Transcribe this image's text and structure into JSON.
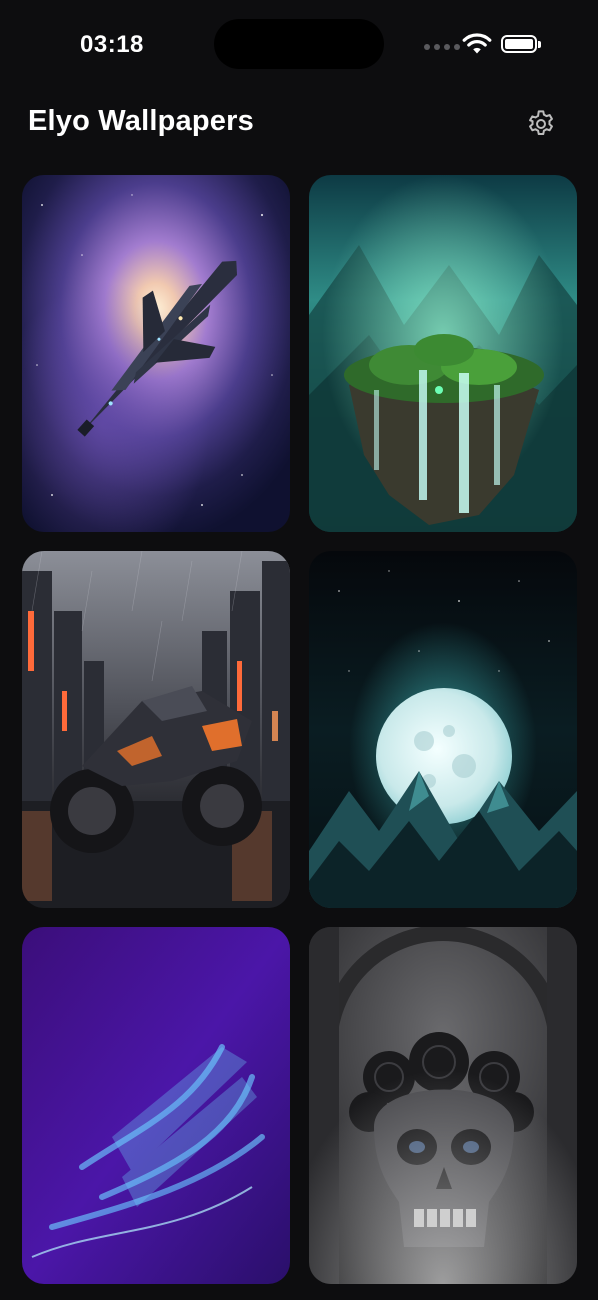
{
  "status_bar": {
    "time": "03:18",
    "wifi_icon": "wifi-icon",
    "battery_icon": "battery-icon",
    "signal_icon": "cellular-dots-icon"
  },
  "header": {
    "title": "Elyo Wallpapers",
    "settings_icon": "gear-icon"
  },
  "wallpapers": [
    {
      "name": "spaceship-nebula",
      "accent": "#b9a2e8"
    },
    {
      "name": "floating-island-waterfall",
      "accent": "#2fd9b0"
    },
    {
      "name": "motorcycle-rainy-city",
      "accent": "#ff8a3a"
    },
    {
      "name": "moon-over-mountains",
      "accent": "#49e0e0"
    },
    {
      "name": "glass-ribbon-abstract",
      "accent": "#4fd2ff"
    },
    {
      "name": "rose-crowned-skull",
      "accent": "#9a9a9a"
    }
  ]
}
